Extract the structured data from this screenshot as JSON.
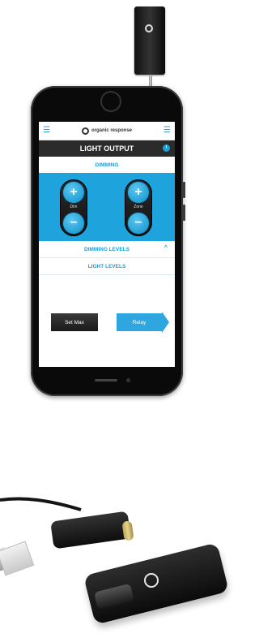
{
  "app": {
    "brand": "organic response",
    "title": "LIGHT OUTPUT",
    "info_icon": "i"
  },
  "sections": {
    "dimming": "DIMMING",
    "dimming_levels": "DIMMING LEVELS",
    "light_levels": "LIGHT LEVELS"
  },
  "controls": {
    "left_label": "Dim",
    "right_label": "Zone",
    "plus": "+",
    "minus": "−"
  },
  "buttons": {
    "set_max": "Set Max",
    "relay": "Relay"
  },
  "icons": {
    "menu_left": "menu-icon",
    "menu_right": "menu-icon",
    "caret": "chevron-up-icon"
  },
  "colors": {
    "accent": "#1ea3dc",
    "titlebar": "#2b2b2b"
  }
}
